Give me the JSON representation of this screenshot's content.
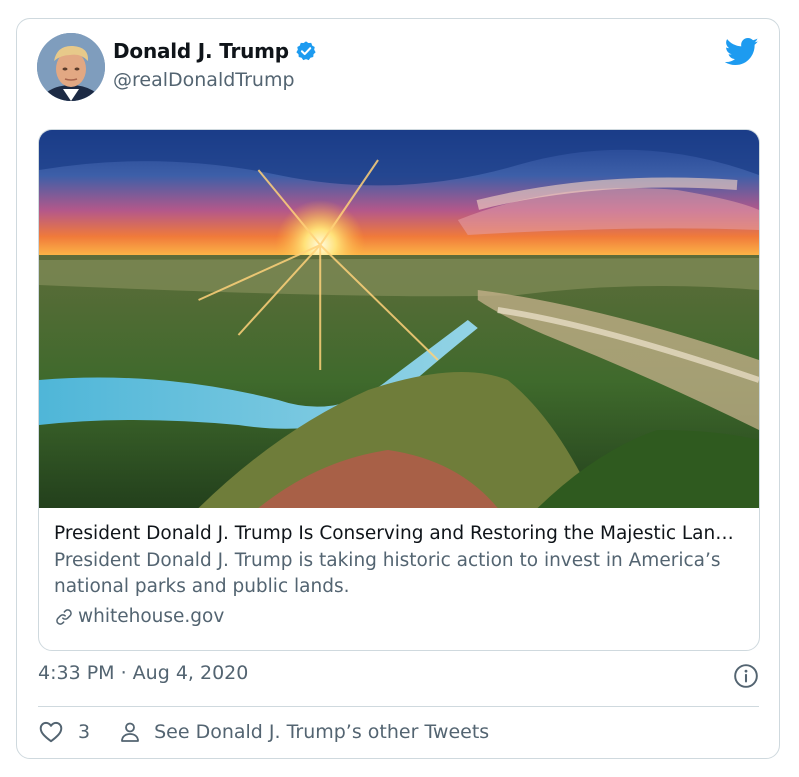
{
  "tweet": {
    "author": {
      "display_name": "Donald J. Trump",
      "handle": "@realDonaldTrump",
      "verified": true
    },
    "card": {
      "title": "President Donald J. Trump Is Conserving and Restoring the Majestic Lands of Our Nation",
      "description": "President Donald J. Trump is taking historic action to invest in America’s national parks and public lands.",
      "domain": "whitehouse.gov"
    },
    "timestamp": "4:33 PM · Aug 4, 2020",
    "likes_count": "3",
    "see_others_label": "See Donald J. Trump’s other Tweets"
  },
  "colors": {
    "brand_blue": "#1d9bf0",
    "secondary_text": "#536471",
    "border": "#cfd9de"
  },
  "icons": {
    "logo": "twitter-bird-icon",
    "verified": "verified-badge-icon",
    "link": "link-icon",
    "info": "info-icon",
    "like": "heart-icon",
    "profile": "person-icon"
  }
}
